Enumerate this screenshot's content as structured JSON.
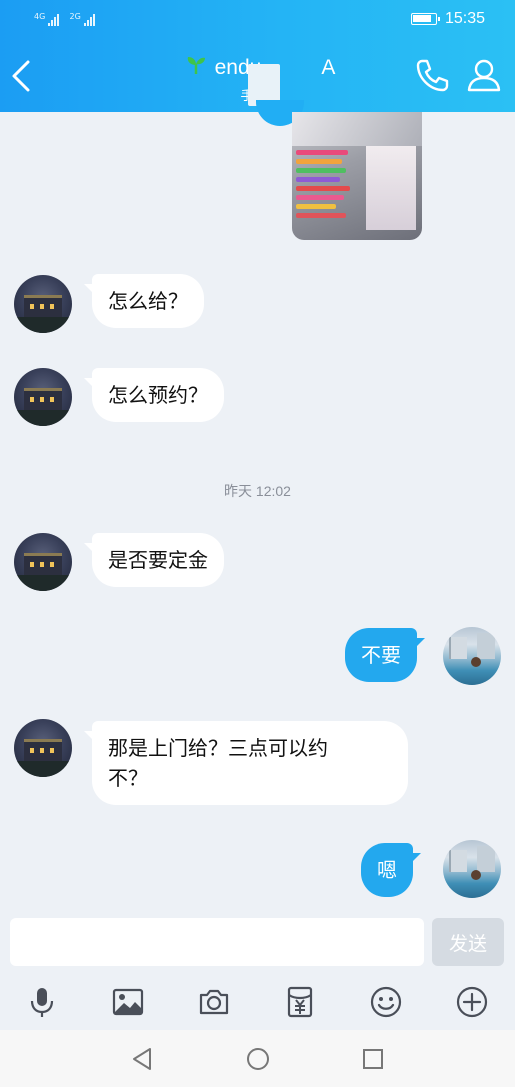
{
  "status_bar": {
    "left_network_1": "4G",
    "left_network_2": "2G",
    "time": "15:35"
  },
  "header": {
    "title": "endu",
    "title_suffix": "A",
    "subtitle": "手机在",
    "title_icon": "sprout-icon",
    "back_icon": "back-chevron-icon",
    "call_icon": "phone-icon",
    "profile_icon": "person-icon"
  },
  "messages": {
    "image_message": {
      "icon": "image-thumbnail"
    },
    "m1": {
      "text": "怎么给？"
    },
    "m2": {
      "text": "怎么预约？"
    },
    "timestamp": "昨天 12:02",
    "m3": {
      "text": "是否要定金"
    },
    "m4": {
      "text": "不要"
    },
    "m5": {
      "line1": "那是上门给？三点可以约",
      "line2": "不？"
    },
    "m6": {
      "text": "嗯"
    }
  },
  "composer": {
    "input_value": "",
    "send_label": "发送"
  },
  "toolbar": {
    "items": [
      "microphone-icon",
      "image-icon",
      "camera-icon",
      "red-packet-icon",
      "emoji-icon",
      "plus-icon"
    ]
  },
  "navbar": {
    "items": [
      "back-triangle-icon",
      "home-circle-icon",
      "recents-square-icon"
    ]
  },
  "colors": {
    "header_start": "#1b9df3",
    "header_end": "#2bc0f4",
    "my_bubble": "#23a8ee",
    "background": "#edf1f6"
  }
}
